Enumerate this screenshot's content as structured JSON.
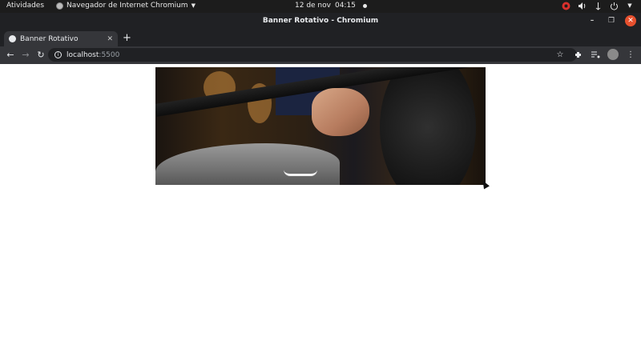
{
  "topbar": {
    "activities": "Atividades",
    "app_name": "Navegador de Internet Chromium",
    "date": "12 de nov",
    "time": "04:15"
  },
  "window": {
    "title": "Banner Rotativo - Chromium"
  },
  "tabs": [
    {
      "label": "Banner Rotativo"
    }
  ],
  "toolbar": {
    "url_host": "localhost",
    "url_port": ":5500"
  },
  "icons": {
    "topbar": [
      "chrome-app-icon",
      "screen-record-icon",
      "volume-icon",
      "network-icon",
      "power-icon"
    ],
    "window": [
      "minimize-icon",
      "maximize-icon",
      "close-icon"
    ],
    "toolbar": [
      "back-icon",
      "forward-icon",
      "reload-icon",
      "site-info-icon",
      "bookmark-star-icon",
      "extensions-icon",
      "media-control-icon",
      "profile-avatar",
      "menu-kebab-icon"
    ]
  },
  "colors": {
    "topbar_bg": "#1c1c1c",
    "chrome_bg": "#202124",
    "toolbar_bg": "#35363a",
    "close_accent": "#e6502e"
  }
}
